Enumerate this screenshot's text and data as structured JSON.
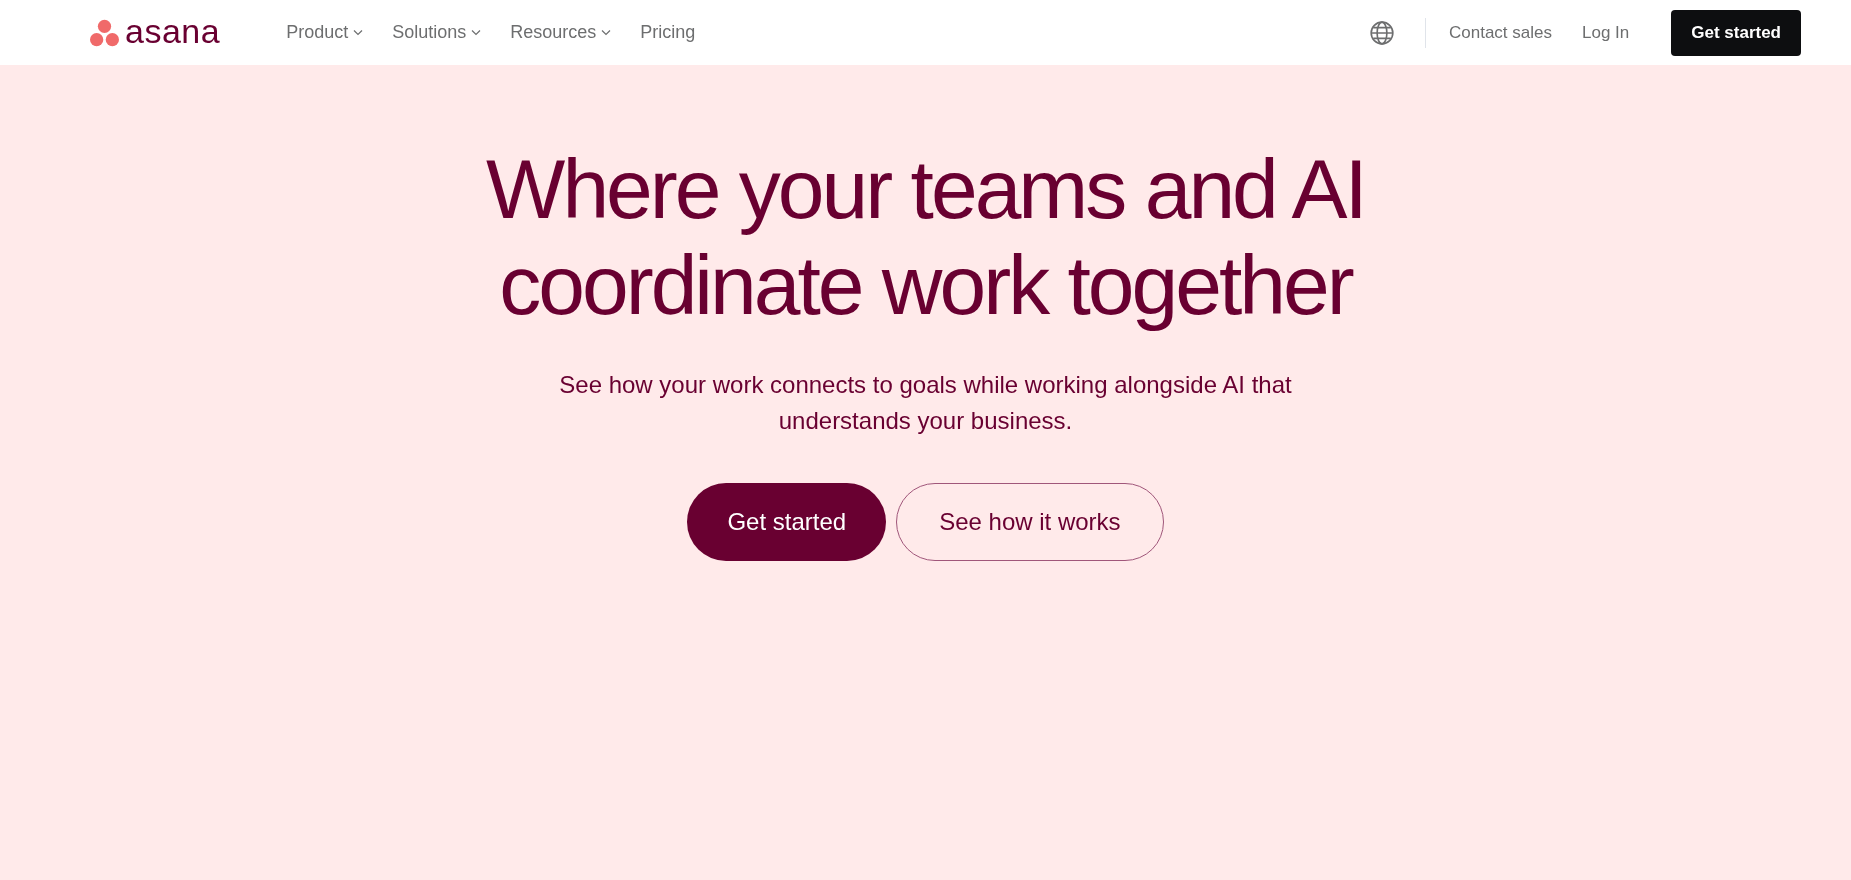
{
  "header": {
    "logo": {
      "text": "asana"
    },
    "nav": [
      {
        "label": "Product",
        "has_menu": true
      },
      {
        "label": "Solutions",
        "has_menu": true
      },
      {
        "label": "Resources",
        "has_menu": true
      },
      {
        "label": "Pricing",
        "has_menu": false
      }
    ],
    "links": [
      "Contact sales",
      "Log In"
    ],
    "cta": "Get started"
  },
  "hero": {
    "headline": [
      "Where your teams and AI",
      "coordinate work together"
    ],
    "subtitle": "See how your work connects to goals while working alongside AI that understands your business.",
    "buttons": [
      {
        "label": "Get started",
        "kind": "primary"
      },
      {
        "label": "See how it works",
        "kind": "secondary"
      }
    ]
  }
}
